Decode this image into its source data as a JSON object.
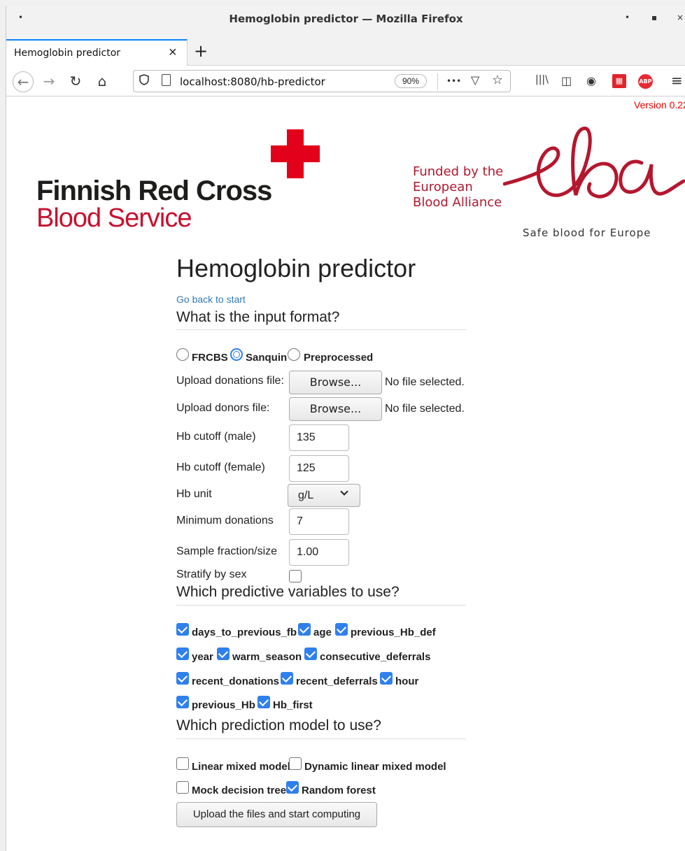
{
  "window": {
    "title": "Hemoglobin predictor — Mozilla Firefox",
    "menu_glyph": "•",
    "minimize_glyph": "•",
    "maximize_glyph": "▪",
    "close_glyph": "×"
  },
  "tabs": [
    {
      "label": "Hemoglobin predictor",
      "close": "×"
    }
  ],
  "new_tab_glyph": "+",
  "nav": {
    "back_glyph": "←",
    "forward_glyph": "→",
    "reload_glyph": "↻",
    "home_glyph": "⌂",
    "url": "localhost:8080/hb-predictor",
    "zoom": "90%",
    "more_glyph": "•••",
    "pocket_glyph": "▽",
    "bookmark_glyph": "☆",
    "library_glyph": "|||\\",
    "sidebar_glyph": "◫",
    "account_glyph": "◉",
    "ublock_glyph": "▦",
    "abp_label": "ABP",
    "menu_glyph": "≡"
  },
  "page": {
    "version": "Version 0.22",
    "frc_line1": "Finnish Red Cross",
    "frc_line2": "Blood Service",
    "eba_funded": [
      "Funded by the",
      "European",
      "Blood Alliance"
    ],
    "eba_logo_text": "eba",
    "eba_tagline": "Safe blood for Europe",
    "title": "Hemoglobin predictor",
    "back_link": "Go back to start",
    "input_format": {
      "heading": "What is the input format?",
      "options": [
        {
          "label": "FRCBS",
          "selected": false
        },
        {
          "label": "Sanquin",
          "selected": true
        },
        {
          "label": "Preprocessed",
          "selected": false
        }
      ]
    },
    "uploads": [
      {
        "label": "Upload donations file:",
        "button": "Browse...",
        "status": "No file selected."
      },
      {
        "label": "Upload donors file:",
        "button": "Browse...",
        "status": "No file selected."
      }
    ],
    "fields": {
      "hb_male": {
        "label": "Hb cutoff (male)",
        "value": "135"
      },
      "hb_female": {
        "label": "Hb cutoff (female)",
        "value": "125"
      },
      "hb_unit": {
        "label": "Hb unit",
        "value": "g/L"
      },
      "min_donations": {
        "label": "Minimum donations",
        "value": "7"
      },
      "sample_fraction": {
        "label": "Sample fraction/size",
        "value": "1.00"
      },
      "stratify": {
        "label": "Stratify by sex",
        "checked": false
      }
    },
    "variables": {
      "heading": "Which predictive variables to use?",
      "items": [
        {
          "label": "days_to_previous_fb",
          "checked": true
        },
        {
          "label": "age",
          "checked": true
        },
        {
          "label": "previous_Hb_def",
          "checked": true
        },
        {
          "label": "year",
          "checked": true
        },
        {
          "label": "warm_season",
          "checked": true
        },
        {
          "label": "consecutive_deferrals",
          "checked": true
        },
        {
          "label": "recent_donations",
          "checked": true
        },
        {
          "label": "recent_deferrals",
          "checked": true
        },
        {
          "label": "hour",
          "checked": true
        },
        {
          "label": "previous_Hb",
          "checked": true
        },
        {
          "label": "Hb_first",
          "checked": true
        }
      ]
    },
    "models": {
      "heading": "Which prediction model to use?",
      "items": [
        {
          "label": "Linear mixed model",
          "checked": false
        },
        {
          "label": "Dynamic linear mixed model",
          "checked": false
        },
        {
          "label": "Mock decision tree",
          "checked": false
        },
        {
          "label": "Random forest",
          "checked": true
        }
      ]
    },
    "submit_label": "Upload the files and start computing"
  }
}
